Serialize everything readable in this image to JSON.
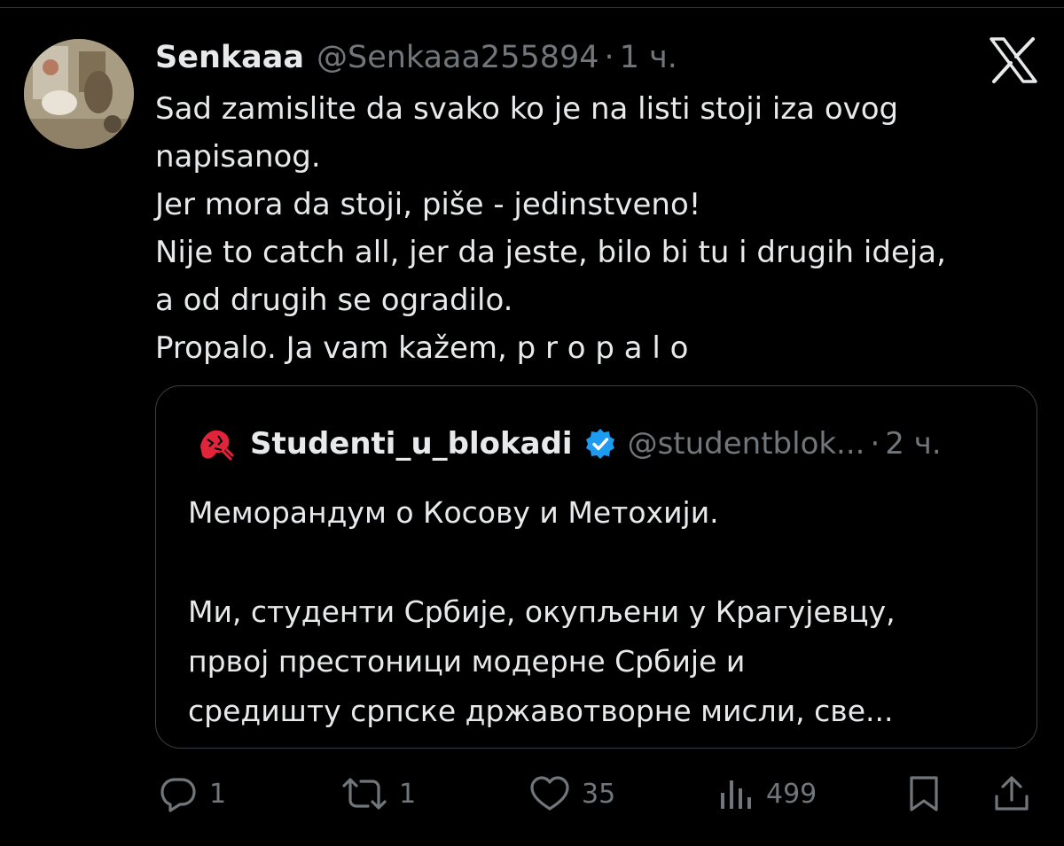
{
  "tweet": {
    "display_name": "Senkaaa",
    "handle": "@Senkaaa255894",
    "separator": "·",
    "time": "1 ч.",
    "text_lines": [
      "Sad zamislite da svako ko je na listi stoji iza ovog",
      "napisanog.",
      "Jer mora da stoji, piše - jedinstveno!",
      "Nije to catch all, jer da jeste, bilo bi tu i drugih ideja,",
      "a od drugih se ogradilo.",
      "Propalo. Ja vam kažem, p r o p a l o"
    ]
  },
  "quote": {
    "display_name": "Studenti_u_blokadi",
    "handle": "@studentblok...",
    "separator": "·",
    "time": "2 ч.",
    "verified": true,
    "text_lines": [
      "Меморандум о Косову и Метохији.",
      "",
      "Ми, студенти Србије, окупљени у Крагујевцу,",
      "првој престоници модерне Србије и",
      "средишту српске државотворне мисли, све..."
    ]
  },
  "actions": {
    "replies": "1",
    "reposts": "1",
    "likes": "35",
    "views": "499"
  },
  "icons": {
    "reply": "reply-icon",
    "repost": "repost-icon",
    "like": "heart-icon",
    "views": "views-icon",
    "bookmark": "bookmark-icon",
    "share": "share-icon",
    "logo": "x-logo-icon",
    "verified": "verified-badge-icon"
  },
  "colors": {
    "background": "#000000",
    "text": "#e7e9ea",
    "secondary_text": "#71767b",
    "border": "#3a3f44",
    "verified_blue": "#1d9bf0",
    "quote_logo_red": "#e0243a"
  }
}
